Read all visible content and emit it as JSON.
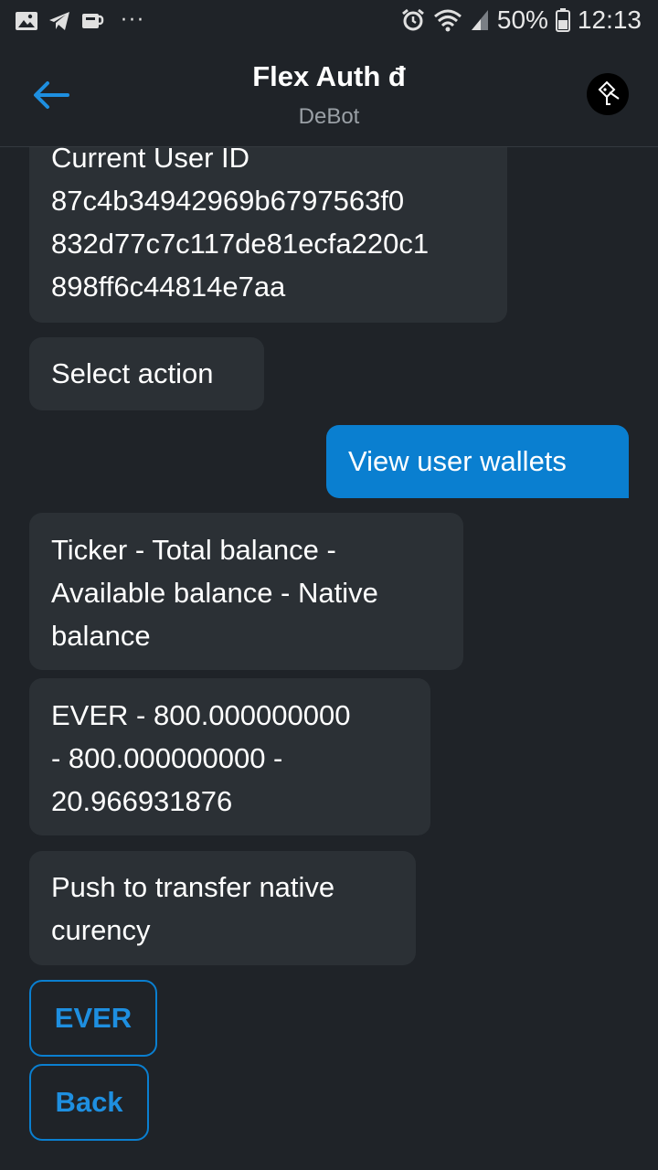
{
  "status_bar": {
    "battery": "50%",
    "time": "12:13",
    "more": "···"
  },
  "header": {
    "title": "Flex Auth đ",
    "subtitle": "DeBot"
  },
  "messages": [
    {
      "from": "bot",
      "lines": [
        "Current User ID",
        "87c4b34942969b6797563f0",
        "832d77c7c117de81ecfa220c1",
        "898ff6c44814e7aa"
      ]
    },
    {
      "from": "bot",
      "lines": [
        "Select action"
      ]
    },
    {
      "from": "user",
      "lines": [
        "View user wallets"
      ]
    },
    {
      "from": "bot",
      "lines": [
        "Ticker - Total balance -",
        "Available balance - Native",
        "balance"
      ]
    },
    {
      "from": "bot",
      "lines": [
        "EVER - 800.000000000",
        "- 800.000000000 -",
        "20.966931876"
      ]
    },
    {
      "from": "bot",
      "lines": [
        "Push to transfer native",
        "curency"
      ]
    }
  ],
  "action_buttons": {
    "ever": "EVER",
    "back": "Back"
  },
  "colors": {
    "background": "#1f2328",
    "bot_bubble": "#2b3035",
    "user_bubble": "#0a7fd0",
    "accent": "#1e8fe0"
  }
}
